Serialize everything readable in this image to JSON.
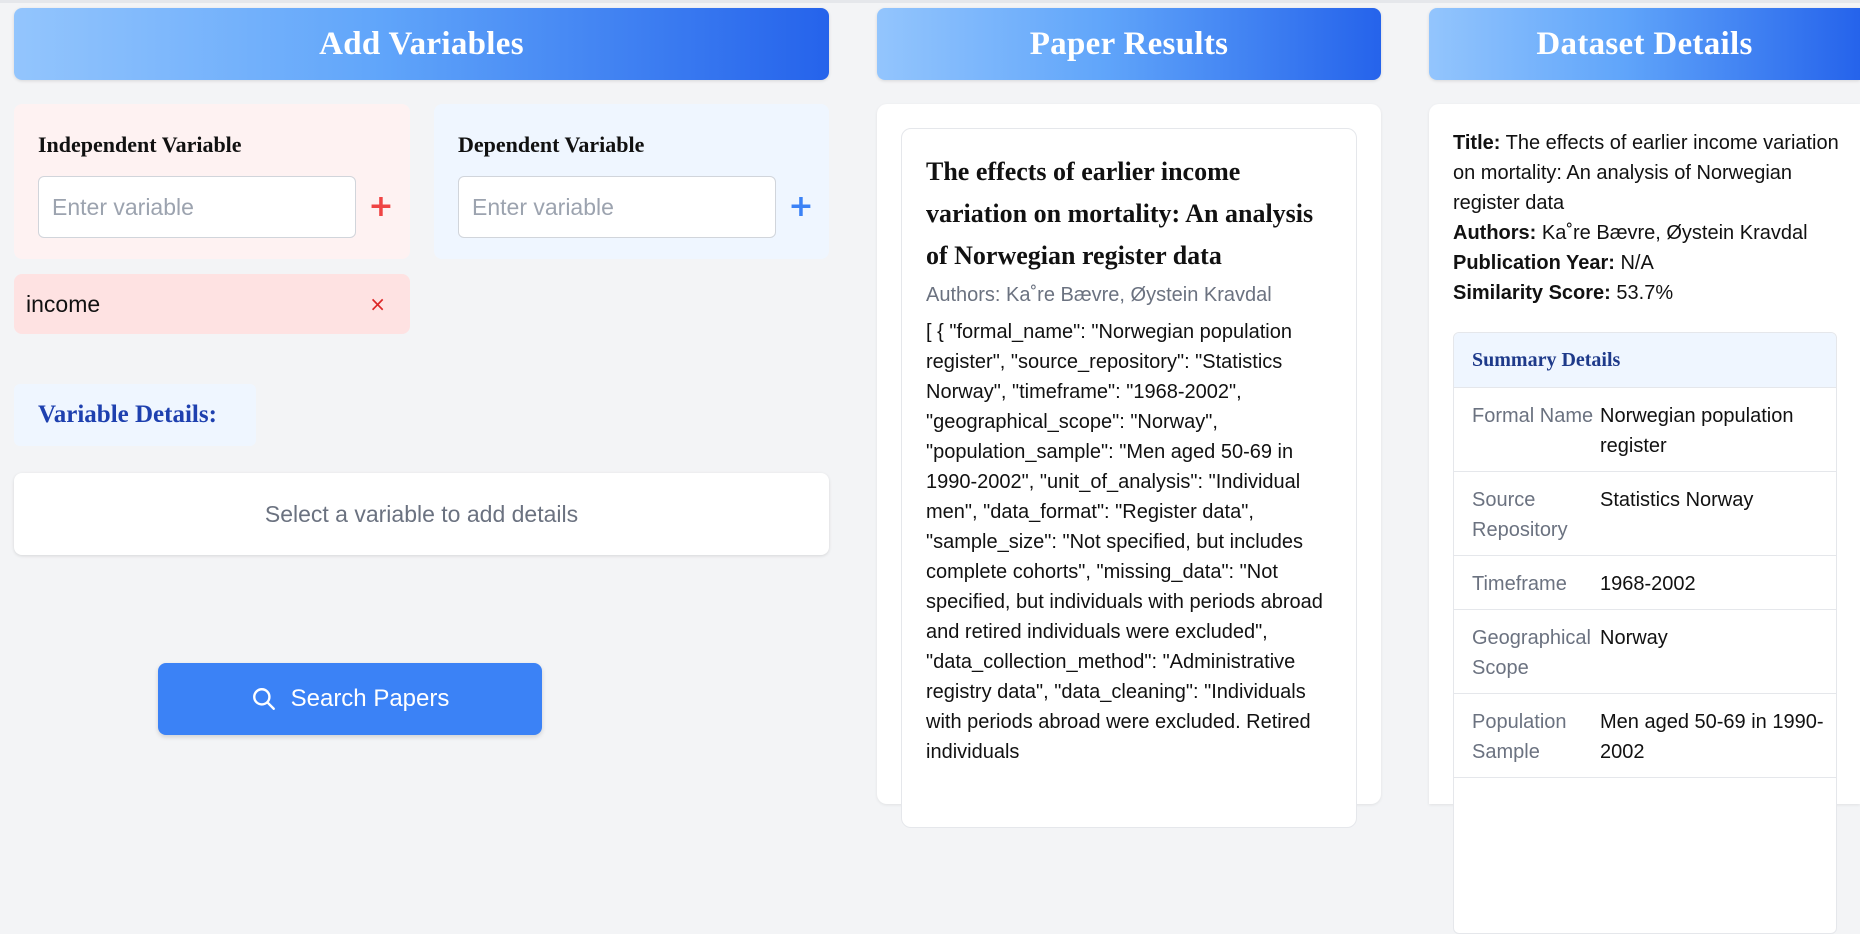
{
  "headers": {
    "add_variables": "Add Variables",
    "paper_results": "Paper Results",
    "dataset_details": "Dataset Details"
  },
  "independent": {
    "label": "Independent Variable",
    "placeholder": "Enter variable",
    "add_symbol": "+"
  },
  "dependent": {
    "label": "Dependent Variable",
    "placeholder": "Enter variable",
    "add_symbol": "+"
  },
  "chip": {
    "label": "income",
    "remove_symbol": "×"
  },
  "variable_details": {
    "heading": "Variable Details:",
    "empty_message": "Select a variable to add details"
  },
  "search_button": {
    "label": "Search Papers"
  },
  "paper": {
    "title": "The effects of earlier income variation on mortality: An analysis of Norwegian register data",
    "authors": "Authors: Ka˚re Bævre, Øystein Kravdal",
    "body": "[ { \"formal_name\": \"Norwegian population register\", \"source_repository\": \"Statistics Norway\", \"timeframe\": \"1968-2002\", \"geographical_scope\": \"Norway\", \"population_sample\": \"Men aged 50-69 in 1990-2002\", \"unit_of_analysis\": \"Individual men\", \"data_format\": \"Register data\", \"sample_size\": \"Not specified, but includes complete cohorts\", \"missing_data\": \"Not specified, but individuals with periods abroad and retired individuals were excluded\", \"data_collection_method\": \"Administrative registry data\", \"data_cleaning\": \"Individuals with periods abroad were excluded. Retired individuals"
  },
  "dataset": {
    "title_label": "Title:",
    "title_value": "The effects of earlier income variation on mortality: An analysis of Norwegian register data",
    "authors_label": "Authors:",
    "authors_value": "Ka˚re Bævre, Øystein Kravdal",
    "year_label": "Publication Year:",
    "year_value": "N/A",
    "similarity_label": "Similarity Score:",
    "similarity_value": "53.7%",
    "summary_heading": "Summary Details",
    "summary_rows": [
      {
        "key": "Formal Name",
        "value": "Norwegian population register"
      },
      {
        "key": "Source Repository",
        "value": "Statistics Norway"
      },
      {
        "key": "Timeframe",
        "value": "1968-2002"
      },
      {
        "key": "Geographical Scope",
        "value": "Norway"
      },
      {
        "key": "Population Sample",
        "value": "Men aged 50-69 in 1990-2002"
      }
    ]
  },
  "colors": {
    "header_gradient_start": "#93c5fd",
    "header_gradient_end": "#2563eb",
    "independent_accent": "#ef4444",
    "dependent_accent": "#3b82f6",
    "search_button": "#3b82f6"
  }
}
